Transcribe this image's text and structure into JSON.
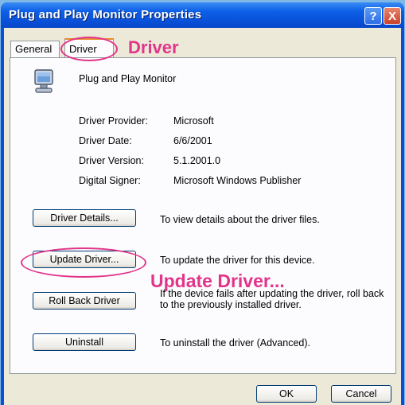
{
  "window": {
    "title": "Plug and Play Monitor Properties",
    "help": "?",
    "close": "X"
  },
  "tabs": [
    {
      "label": "General"
    },
    {
      "label": "Driver"
    }
  ],
  "device": {
    "name": "Plug and Play Monitor"
  },
  "info": {
    "provider_label": "Driver Provider:",
    "provider_value": "Microsoft",
    "date_label": "Driver Date:",
    "date_value": "6/6/2001",
    "version_label": "Driver Version:",
    "version_value": "5.1.2001.0",
    "signer_label": "Digital Signer:",
    "signer_value": "Microsoft Windows Publisher"
  },
  "actions": {
    "details": {
      "label": "Driver Details...",
      "desc": "To view details about the driver files."
    },
    "update": {
      "label": "Update Driver...",
      "desc": "To update the driver for this device."
    },
    "rollback": {
      "label": "Roll Back Driver",
      "desc": "If the device fails after updating the driver, roll back to the previously installed driver."
    },
    "uninstall": {
      "label": "Uninstall",
      "desc": "To uninstall the driver (Advanced)."
    }
  },
  "footer": {
    "ok": "OK",
    "cancel": "Cancel"
  },
  "annotations": {
    "driver": "Driver",
    "update": "Update Driver...",
    "color": "#e2358a"
  }
}
